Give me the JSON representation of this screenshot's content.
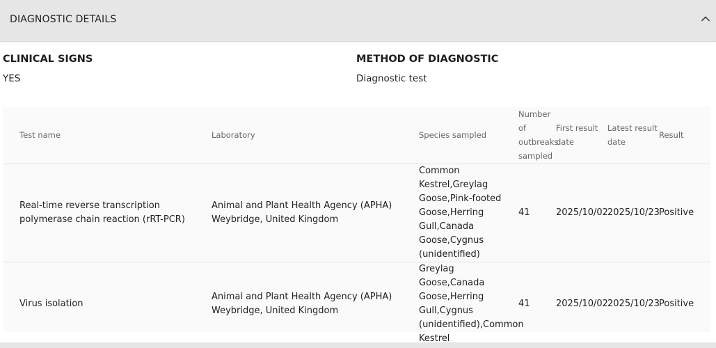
{
  "section": {
    "title": "DIAGNOSTIC DETAILS"
  },
  "fields": {
    "clinical_signs": {
      "label": "CLINICAL SIGNS",
      "value": "YES"
    },
    "method": {
      "label": "METHOD OF DIAGNOSTIC",
      "value": "Diagnostic test"
    }
  },
  "table": {
    "headers": [
      "Test name",
      "Laboratory",
      "Species sampled",
      "Number of outbreaks sampled",
      "First result date",
      "Latest result date",
      "Result"
    ],
    "rows": [
      [
        "Real-time reverse transcription polymerase chain reaction (rRT-PCR)",
        "Animal and Plant Health Agency (APHA) Weybridge, United Kingdom",
        "Common Kestrel,Greylag Goose,Pink-footed Goose,Herring Gull,Canada Goose,Cygnus (unidentified)",
        "41",
        "2025/10/02",
        "2025/10/23",
        "Positive"
      ],
      [
        "Virus isolation",
        "Animal and Plant Health Agency (APHA) Weybridge, United Kingdom",
        "Greylag Goose,Canada Goose,Herring Gull,Cygnus (unidentified),Common Kestrel",
        "41",
        "2025/10/02",
        "2025/10/23",
        "Positive"
      ]
    ]
  },
  "icons": {
    "collapse": "chevron-up-icon"
  }
}
